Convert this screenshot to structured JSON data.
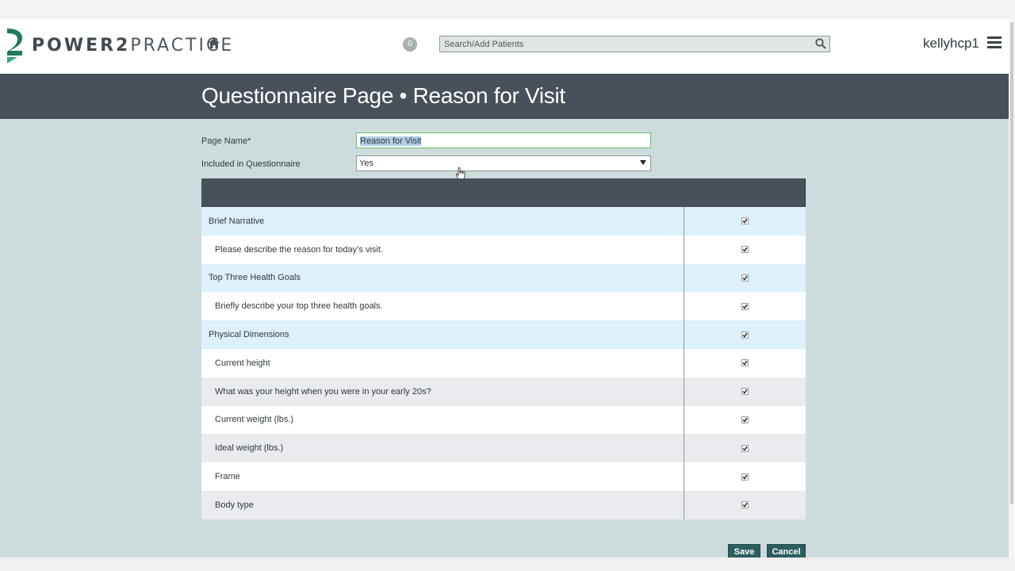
{
  "header": {
    "brand_bold": "POWER2",
    "brand_light": "PRACTICE",
    "notification_count": "0",
    "search_placeholder": "Search/Add Patients",
    "username": "kellyhcp1"
  },
  "page": {
    "title": "Questionnaire Page • Reason for Visit"
  },
  "form": {
    "page_name_label": "Page Name*",
    "page_name_value": "Reason for Visit",
    "included_label": "Included in Questionnaire",
    "included_value": "Yes"
  },
  "table": {
    "rows": [
      {
        "text": "Brief Narrative",
        "kind": "group",
        "checked": true
      },
      {
        "text": "Please describe the reason for today’s visit.",
        "kind": "item",
        "checked": true
      },
      {
        "text": "Top Three Health Goals",
        "kind": "group",
        "checked": true
      },
      {
        "text": "Briefly describe your top three health goals.",
        "kind": "item",
        "checked": true
      },
      {
        "text": "Physical Dimensions",
        "kind": "group",
        "checked": true
      },
      {
        "text": "Current height",
        "kind": "item",
        "checked": true
      },
      {
        "text": "What was your height when you were in your early 20s?",
        "kind": "item",
        "checked": true
      },
      {
        "text": "Current weight (lbs.)",
        "kind": "item",
        "checked": true
      },
      {
        "text": "Ideal weight (lbs.)",
        "kind": "item",
        "checked": true
      },
      {
        "text": "Frame",
        "kind": "item",
        "checked": true
      },
      {
        "text": "Body type",
        "kind": "item",
        "checked": true
      }
    ]
  },
  "actions": {
    "save_label": "Save",
    "cancel_label": "Cancel"
  },
  "colors": {
    "header_dark": "#48515a",
    "background": "#cddbdc",
    "group_row": "#ddf0fb",
    "button": "#2b5f5e",
    "brand_green": "#1f7a5a"
  },
  "icons": {
    "home": "home-icon",
    "search": "search-icon",
    "menu": "hamburger-menu-icon",
    "logo": "power2practice-logo-icon"
  }
}
